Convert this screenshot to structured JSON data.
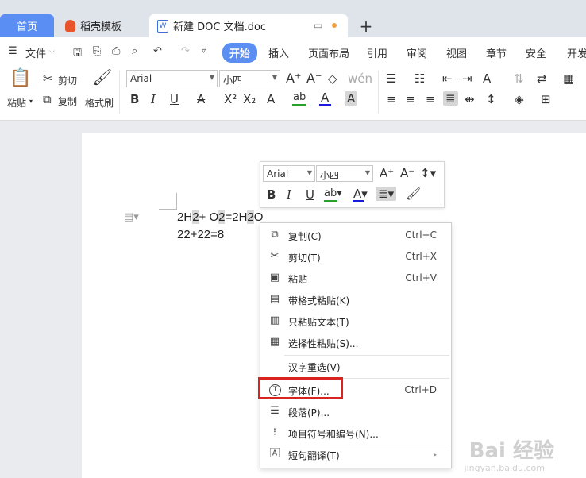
{
  "tabs": {
    "home": "首页",
    "template": "稻壳模板",
    "doc": "新建 DOC 文档.doc",
    "new_tab": "+"
  },
  "menu": {
    "file": "文件",
    "start": "开始",
    "insert": "插入",
    "layout": "页面布局",
    "reference": "引用",
    "review": "审阅",
    "view": "视图",
    "chapter": "章节",
    "security": "安全",
    "dev": "开发"
  },
  "ribbon": {
    "paste": "粘贴",
    "cut": "剪切",
    "copy": "复制",
    "format_painter": "格式刷",
    "font_name": "Arial",
    "font_size": "小四"
  },
  "document": {
    "line1_parts": [
      "2H",
      "2",
      "+ O",
      "2",
      "=2H",
      "2",
      "O"
    ],
    "line2": "22+22=8"
  },
  "mini_toolbar": {
    "font_name": "Arial",
    "font_size": "小四"
  },
  "context_menu": {
    "items": [
      {
        "label": "复制(C)",
        "shortcut": "Ctrl+C",
        "icon": "copy-icon"
      },
      {
        "label": "剪切(T)",
        "shortcut": "Ctrl+X",
        "icon": "scissors-icon"
      },
      {
        "label": "粘贴",
        "shortcut": "Ctrl+V",
        "icon": "paste-icon"
      },
      {
        "label": "带格式粘贴(K)",
        "shortcut": "",
        "icon": "paste-format-icon"
      },
      {
        "label": "只粘贴文本(T)",
        "shortcut": "",
        "icon": "paste-text-icon"
      },
      {
        "label": "选择性粘贴(S)...",
        "shortcut": "",
        "icon": "paste-special-icon"
      },
      {
        "label": "汉字重选(V)",
        "shortcut": "",
        "icon": ""
      },
      {
        "label": "字体(F)...",
        "shortcut": "Ctrl+D",
        "icon": "font-icon"
      },
      {
        "label": "段落(P)...",
        "shortcut": "",
        "icon": "paragraph-icon"
      },
      {
        "label": "项目符号和编号(N)...",
        "shortcut": "",
        "icon": "list-icon"
      },
      {
        "label": "短句翻译(T)",
        "shortcut": "",
        "icon": "translate-icon"
      }
    ]
  },
  "watermark": {
    "main": "Bai 经验",
    "sub": "jingyan.baidu.com"
  },
  "colors": {
    "accent": "#5a8ef2",
    "highlight_box": "#d9231f",
    "font_color_bar": "#1a1adb",
    "highlight_bar": "#2ca02c"
  }
}
